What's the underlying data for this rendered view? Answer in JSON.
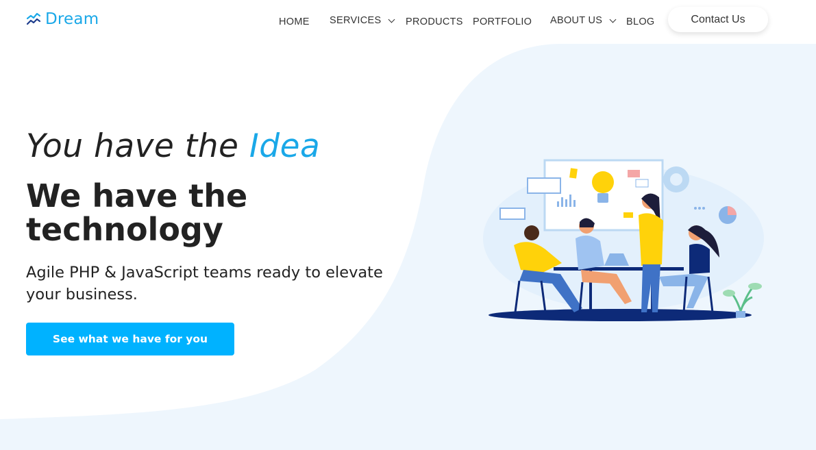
{
  "brand": {
    "name": "Dream",
    "icon": "trend-icon",
    "color": "#1aa8e8"
  },
  "nav": {
    "items": [
      {
        "label": "HOME"
      },
      {
        "label": "SERVICES",
        "icon": "chevron-down-icon"
      },
      {
        "label": "PRODUCTS"
      },
      {
        "label": "PORTFOLIO"
      },
      {
        "label": "ABOUT US",
        "icon": "chevron-down-icon"
      },
      {
        "label": "BLOG"
      }
    ],
    "contact_label": "Contact Us"
  },
  "hero": {
    "line1_prefix": "You have the ",
    "line1_accent": "Idea",
    "title": "We have the technology",
    "subtitle": "Agile PHP & JavaScript teams ready to elevate your business.",
    "cta_label": "See what we have for you",
    "illustration": "team-meeting-illustration"
  },
  "colors": {
    "accent": "#1aa8e8",
    "button": "#00b2ff",
    "background_blob": "#eef6fd",
    "illustration_navy": "#0d2a78",
    "illustration_yellow": "#ffd20a"
  }
}
